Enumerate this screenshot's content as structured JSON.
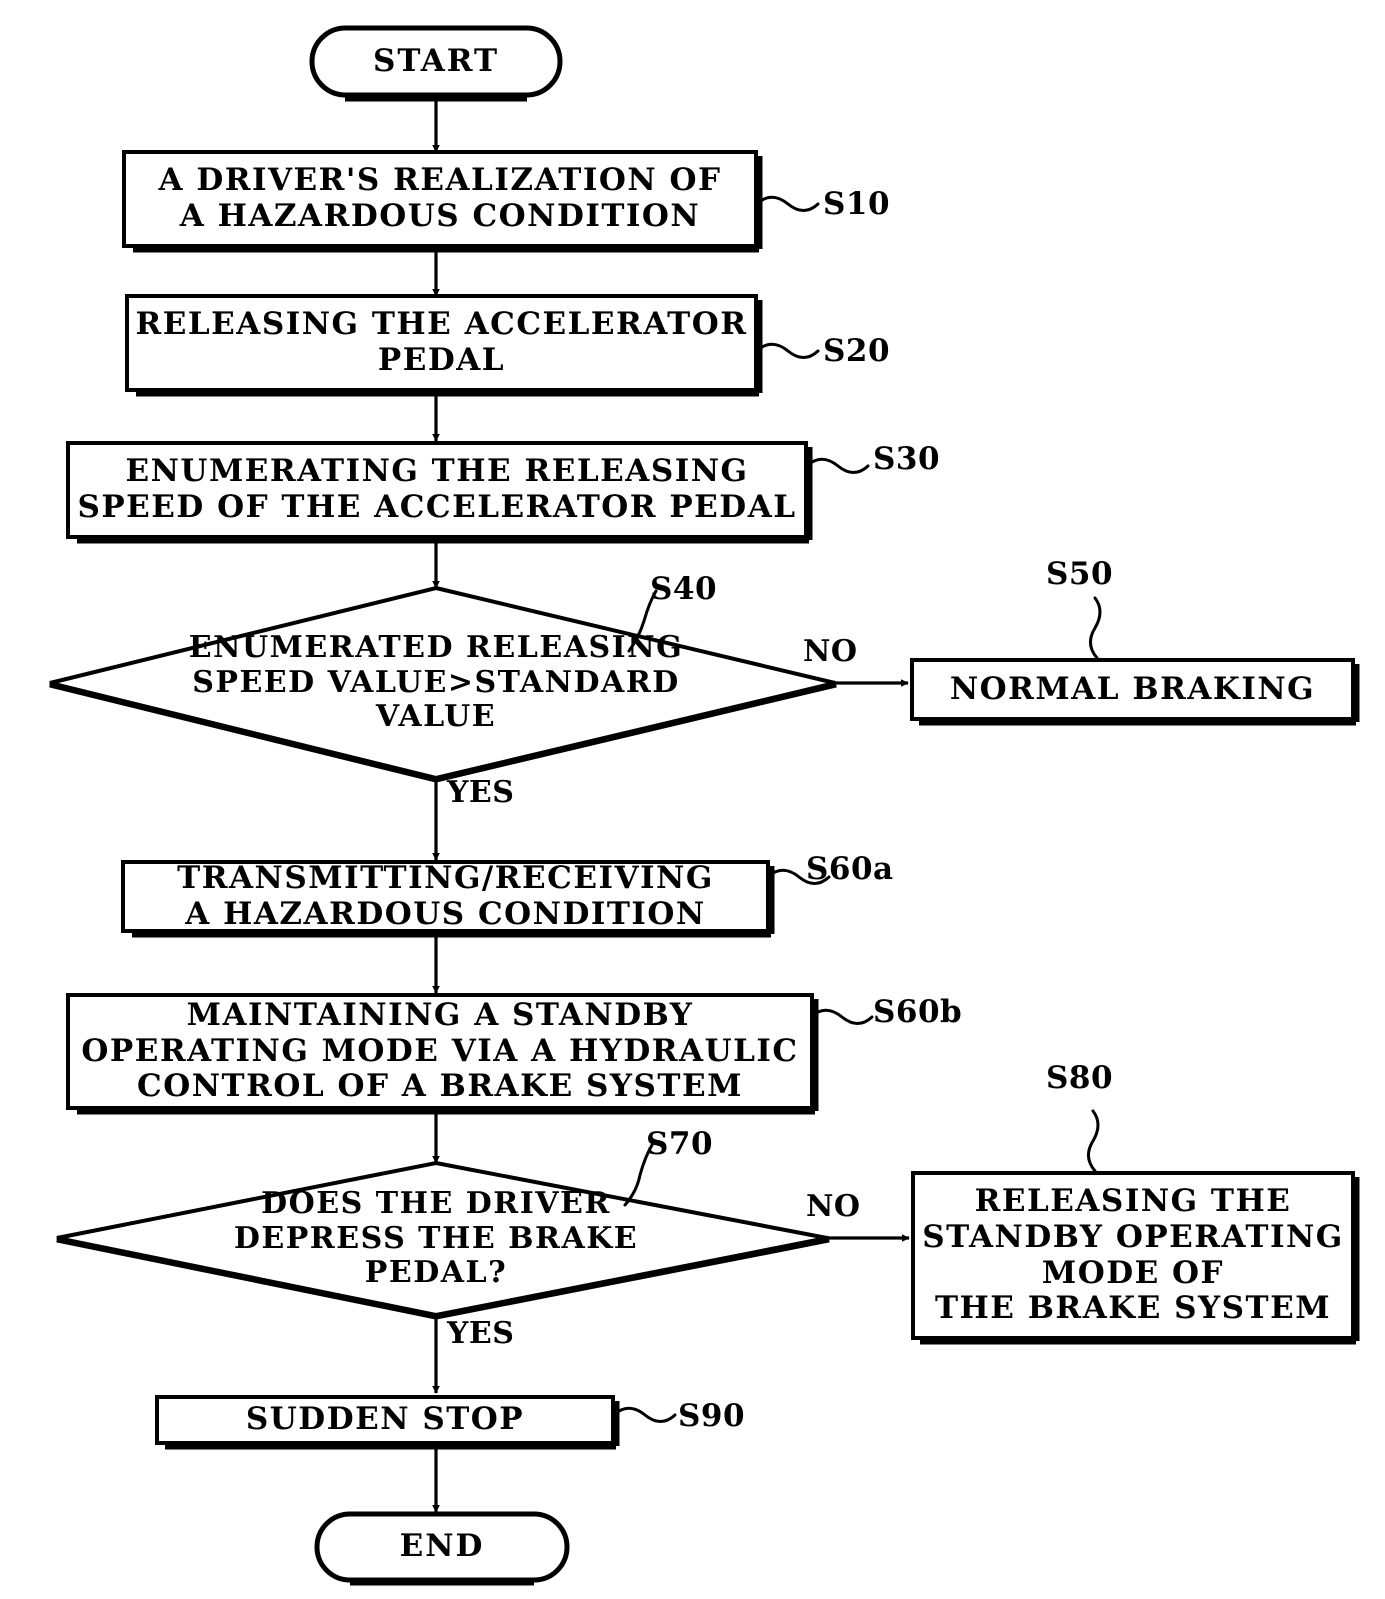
{
  "diagram": {
    "type": "flowchart",
    "title_visible": false,
    "stroke_color": "#000000",
    "fill_color": "#ffffff",
    "background": "#ffffff"
  },
  "nodes": {
    "start": {
      "label": "START",
      "shape": "terminator",
      "ref": ""
    },
    "s10": {
      "label": "A DRIVER'S REALIZATION OF\nA HAZARDOUS CONDITION",
      "shape": "process",
      "ref": "S10"
    },
    "s20": {
      "label": "RELEASING THE ACCELERATOR\nPEDAL",
      "shape": "process",
      "ref": "S20"
    },
    "s30": {
      "label": "ENUMERATING THE RELEASING\nSPEED OF THE ACCELERATOR PEDAL",
      "shape": "process",
      "ref": "S30"
    },
    "s40": {
      "label": "ENUMERATED RELEASING\nSPEED VALUE>STANDARD\nVALUE",
      "shape": "decision",
      "ref": "S40"
    },
    "s50": {
      "label": "NORMAL BRAKING",
      "shape": "process",
      "ref": "S50"
    },
    "s60a": {
      "label": "TRANSMITTING/RECEIVING\nA HAZARDOUS CONDITION",
      "shape": "process",
      "ref": "S60a"
    },
    "s60b": {
      "label": "MAINTAINING A STANDBY\nOPERATING MODE VIA A HYDRAULIC\nCONTROL OF A BRAKE SYSTEM",
      "shape": "process",
      "ref": "S60b"
    },
    "s70": {
      "label": "DOES THE DRIVER\nDEPRESS THE BRAKE\nPEDAL?",
      "shape": "decision",
      "ref": "S70"
    },
    "s80": {
      "label": "RELEASING THE\nSTANDBY OPERATING\nMODE OF\nTHE BRAKE SYSTEM",
      "shape": "process",
      "ref": "S80"
    },
    "s90": {
      "label": "SUDDEN STOP",
      "shape": "process",
      "ref": "S90"
    },
    "end": {
      "label": "END",
      "shape": "terminator",
      "ref": ""
    }
  },
  "edge_labels": {
    "s40_no": "NO",
    "s40_yes": "YES",
    "s70_no": "NO",
    "s70_yes": "YES"
  },
  "flow": [
    {
      "from": "start",
      "to": "s10",
      "label": ""
    },
    {
      "from": "s10",
      "to": "s20",
      "label": ""
    },
    {
      "from": "s20",
      "to": "s30",
      "label": ""
    },
    {
      "from": "s30",
      "to": "s40",
      "label": ""
    },
    {
      "from": "s40",
      "to": "s50",
      "label": "NO"
    },
    {
      "from": "s40",
      "to": "s60a",
      "label": "YES"
    },
    {
      "from": "s60a",
      "to": "s60b",
      "label": ""
    },
    {
      "from": "s60b",
      "to": "s70",
      "label": ""
    },
    {
      "from": "s70",
      "to": "s80",
      "label": "NO"
    },
    {
      "from": "s70",
      "to": "s90",
      "label": "YES"
    },
    {
      "from": "s90",
      "to": "end",
      "label": ""
    }
  ]
}
